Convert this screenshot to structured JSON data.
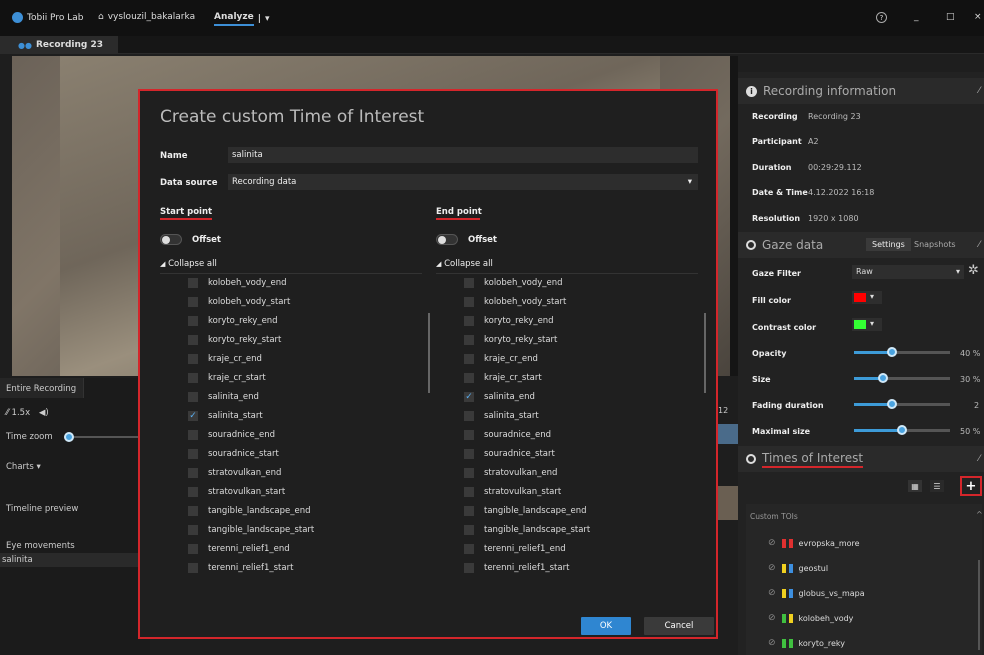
{
  "titlebar": {
    "app_name": "Tobii Pro Lab",
    "project": "vyslouzil_bakalarka",
    "mode": "Analyze",
    "help": "?",
    "minimize": "_",
    "maximize": "□",
    "close": "×"
  },
  "tabs": {
    "recording_tab": "Recording 23"
  },
  "left_panel": {
    "entire_recording": "Entire Recording",
    "speed": "1.5x",
    "time_zoom": "Time zoom",
    "charts": "Charts",
    "timeline_preview": "Timeline preview",
    "eye_movements": "Eye movements",
    "salinita": "salinita",
    "marker": "12"
  },
  "modal": {
    "title": "Create custom Time of Interest",
    "name_label": "Name",
    "name_value": "salinita",
    "datasource_label": "Data source",
    "datasource_value": "Recording data",
    "start_point": "Start point",
    "end_point": "End point",
    "offset": "Offset",
    "collapse_all": "Collapse all",
    "ok": "OK",
    "cancel": "Cancel",
    "start_items": [
      {
        "label": "kolobeh_vody_end",
        "checked": false
      },
      {
        "label": "kolobeh_vody_start",
        "checked": false
      },
      {
        "label": "koryto_reky_end",
        "checked": false
      },
      {
        "label": "koryto_reky_start",
        "checked": false
      },
      {
        "label": "kraje_cr_end",
        "checked": false
      },
      {
        "label": "kraje_cr_start",
        "checked": false
      },
      {
        "label": "salinita_end",
        "checked": false
      },
      {
        "label": "salinita_start",
        "checked": true
      },
      {
        "label": "souradnice_end",
        "checked": false
      },
      {
        "label": "souradnice_start",
        "checked": false
      },
      {
        "label": "stratovulkan_end",
        "checked": false
      },
      {
        "label": "stratovulkan_start",
        "checked": false
      },
      {
        "label": "tangible_landscape_end",
        "checked": false
      },
      {
        "label": "tangible_landscape_start",
        "checked": false
      },
      {
        "label": "terenni_relief1_end",
        "checked": false
      },
      {
        "label": "terenni_relief1_start",
        "checked": false
      }
    ],
    "end_items": [
      {
        "label": "kolobeh_vody_end",
        "checked": false
      },
      {
        "label": "kolobeh_vody_start",
        "checked": false
      },
      {
        "label": "koryto_reky_end",
        "checked": false
      },
      {
        "label": "koryto_reky_start",
        "checked": false
      },
      {
        "label": "kraje_cr_end",
        "checked": false
      },
      {
        "label": "kraje_cr_start",
        "checked": false
      },
      {
        "label": "salinita_end",
        "checked": true
      },
      {
        "label": "salinita_start",
        "checked": false
      },
      {
        "label": "souradnice_end",
        "checked": false
      },
      {
        "label": "souradnice_start",
        "checked": false
      },
      {
        "label": "stratovulkan_end",
        "checked": false
      },
      {
        "label": "stratovulkan_start",
        "checked": false
      },
      {
        "label": "tangible_landscape_end",
        "checked": false
      },
      {
        "label": "tangible_landscape_start",
        "checked": false
      },
      {
        "label": "terenni_relief1_end",
        "checked": false
      },
      {
        "label": "terenni_relief1_start",
        "checked": false
      }
    ]
  },
  "recording_info": {
    "header": "Recording information",
    "recording_label": "Recording",
    "recording_value": "Recording 23",
    "participant_label": "Participant",
    "participant_value": "A2",
    "duration_label": "Duration",
    "duration_value": "00:29:29.112",
    "datetime_label": "Date & Time",
    "datetime_value": "4.12.2022 16:18",
    "resolution_label": "Resolution",
    "resolution_value": "1920 x 1080"
  },
  "gaze_data": {
    "header": "Gaze data",
    "settings_tab": "Settings",
    "snapshots_tab": "Snapshots",
    "gaze_filter_label": "Gaze Filter",
    "gaze_filter_value": "Raw",
    "fill_color_label": "Fill color",
    "fill_color": "#ff0000",
    "contrast_color_label": "Contrast color",
    "contrast_color": "#33ff33",
    "opacity_label": "Opacity",
    "opacity_value": "40 %",
    "opacity_frac": 0.4,
    "size_label": "Size",
    "size_value": "30 %",
    "size_frac": 0.3,
    "fading_label": "Fading duration",
    "fading_value": "2",
    "fading_frac": 0.4,
    "maximal_label": "Maximal size",
    "maximal_value": "50 %",
    "maximal_frac": 0.5
  },
  "toi": {
    "header": "Times of Interest",
    "custom_tois": "Custom TOIs",
    "add": "+",
    "items": [
      {
        "label": "evropska_more",
        "c1": "#e03030",
        "c2": "#e03030"
      },
      {
        "label": "geostul",
        "c1": "#f0d020",
        "c2": "#3d8fe0"
      },
      {
        "label": "globus_vs_mapa",
        "c1": "#f0d020",
        "c2": "#3d8fe0"
      },
      {
        "label": "kolobeh_vody",
        "c1": "#40c040",
        "c2": "#f0d020"
      },
      {
        "label": "koryto_reky",
        "c1": "#40c040",
        "c2": "#40c040"
      }
    ]
  }
}
